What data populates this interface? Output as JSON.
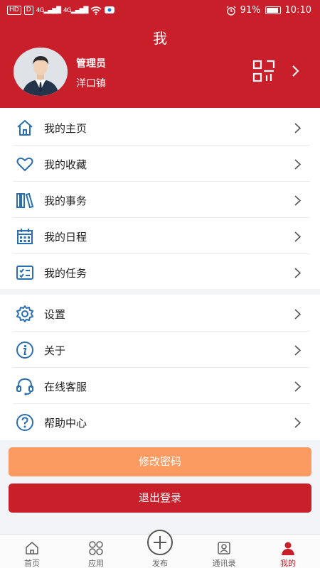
{
  "status_bar": {
    "sim_chip": "HD",
    "sim_chip2": "D",
    "net1": "4G",
    "net2": "4G",
    "battery_text": "91%",
    "battery_level": 0.91,
    "time": "10:10"
  },
  "header": {
    "title": "我",
    "user_name": "管理员",
    "user_town": "洋口镇"
  },
  "menu_group1": [
    {
      "label": "我的主页",
      "icon": "home-icon"
    },
    {
      "label": "我的收藏",
      "icon": "heart-icon"
    },
    {
      "label": "我的事务",
      "icon": "books-icon"
    },
    {
      "label": "我的日程",
      "icon": "calendar-icon"
    },
    {
      "label": "我的任务",
      "icon": "checklist-icon"
    }
  ],
  "menu_group2": [
    {
      "label": "设置",
      "icon": "gear-icon"
    },
    {
      "label": "关于",
      "icon": "info-icon"
    },
    {
      "label": "在线客服",
      "icon": "headset-icon"
    },
    {
      "label": "帮助中心",
      "icon": "help-icon"
    }
  ],
  "buttons": {
    "change_password": "修改密码",
    "logout": "退出登录"
  },
  "tabbar": [
    {
      "label": "首页",
      "icon": "home-tab-icon"
    },
    {
      "label": "应用",
      "icon": "apps-icon"
    },
    {
      "label": "发布",
      "icon": "plus-circle-icon"
    },
    {
      "label": "通讯录",
      "icon": "contacts-icon"
    },
    {
      "label": "我的",
      "icon": "user-icon"
    }
  ],
  "colors": {
    "brand_red": "#c81f2b",
    "orange": "#fb9b62",
    "icon_blue": "#2a6fb0"
  }
}
